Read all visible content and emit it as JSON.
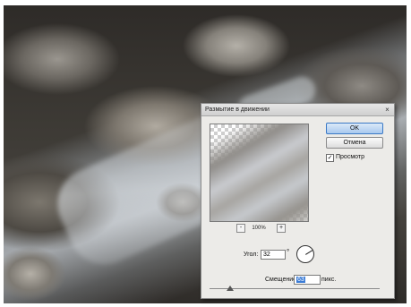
{
  "dialog": {
    "title": "Размытие в движении",
    "ok_label": "OK",
    "cancel_label": "Отмена",
    "preview_label": "Просмотр",
    "preview_checked": true,
    "zoom_out_label": "-",
    "zoom_in_label": "+",
    "zoom_level": "100%",
    "angle_label": "Угол:",
    "angle_value": "32",
    "degree_symbol": "°",
    "offset_label": "Смещение:",
    "offset_value": "63",
    "offset_unit": "пикс.",
    "offset_slider_fraction": 0.12
  },
  "colors": {
    "dialog_bg": "#ecebe8",
    "ok_accent": "#3a78c5",
    "selection": "#3a7bd5"
  }
}
